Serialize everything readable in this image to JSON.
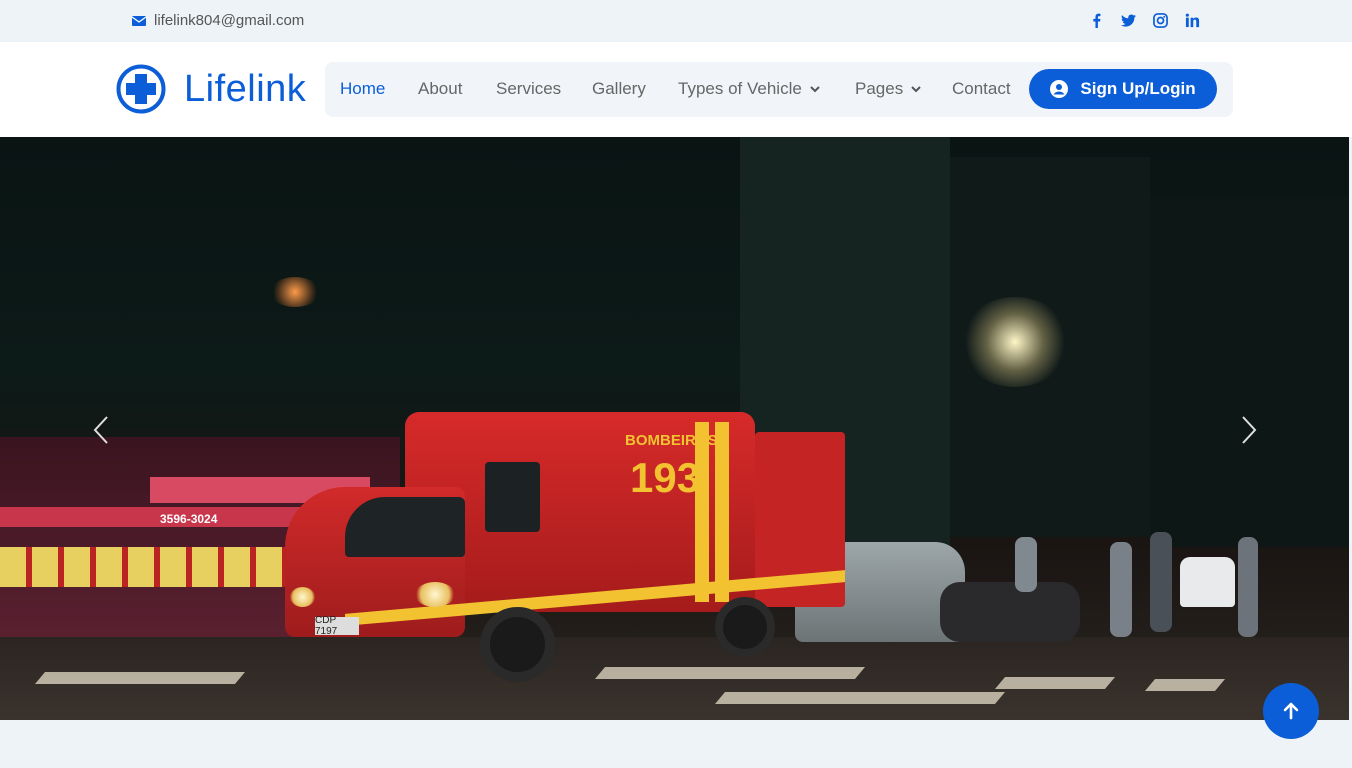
{
  "topbar": {
    "email": "lifelink804@gmail.com",
    "social": [
      "facebook-icon",
      "twitter-icon",
      "instagram-icon",
      "linkedin-icon"
    ]
  },
  "brand": {
    "name": "Lifelink",
    "color": "#0b5ed7"
  },
  "nav": {
    "items": [
      {
        "label": "Home",
        "active": true
      },
      {
        "label": "About"
      },
      {
        "label": "Services"
      },
      {
        "label": "Gallery"
      },
      {
        "label": "Types of Vehicle",
        "dropdown": true
      },
      {
        "label": "Pages",
        "dropdown": true
      },
      {
        "label": "Contact"
      }
    ],
    "login_label": "Sign Up/Login"
  },
  "hero": {
    "ambulance_labels": {
      "brand": "BOMBEIROS",
      "number": "193",
      "plate": "CDP 7197",
      "phone": "3596-3024"
    }
  }
}
